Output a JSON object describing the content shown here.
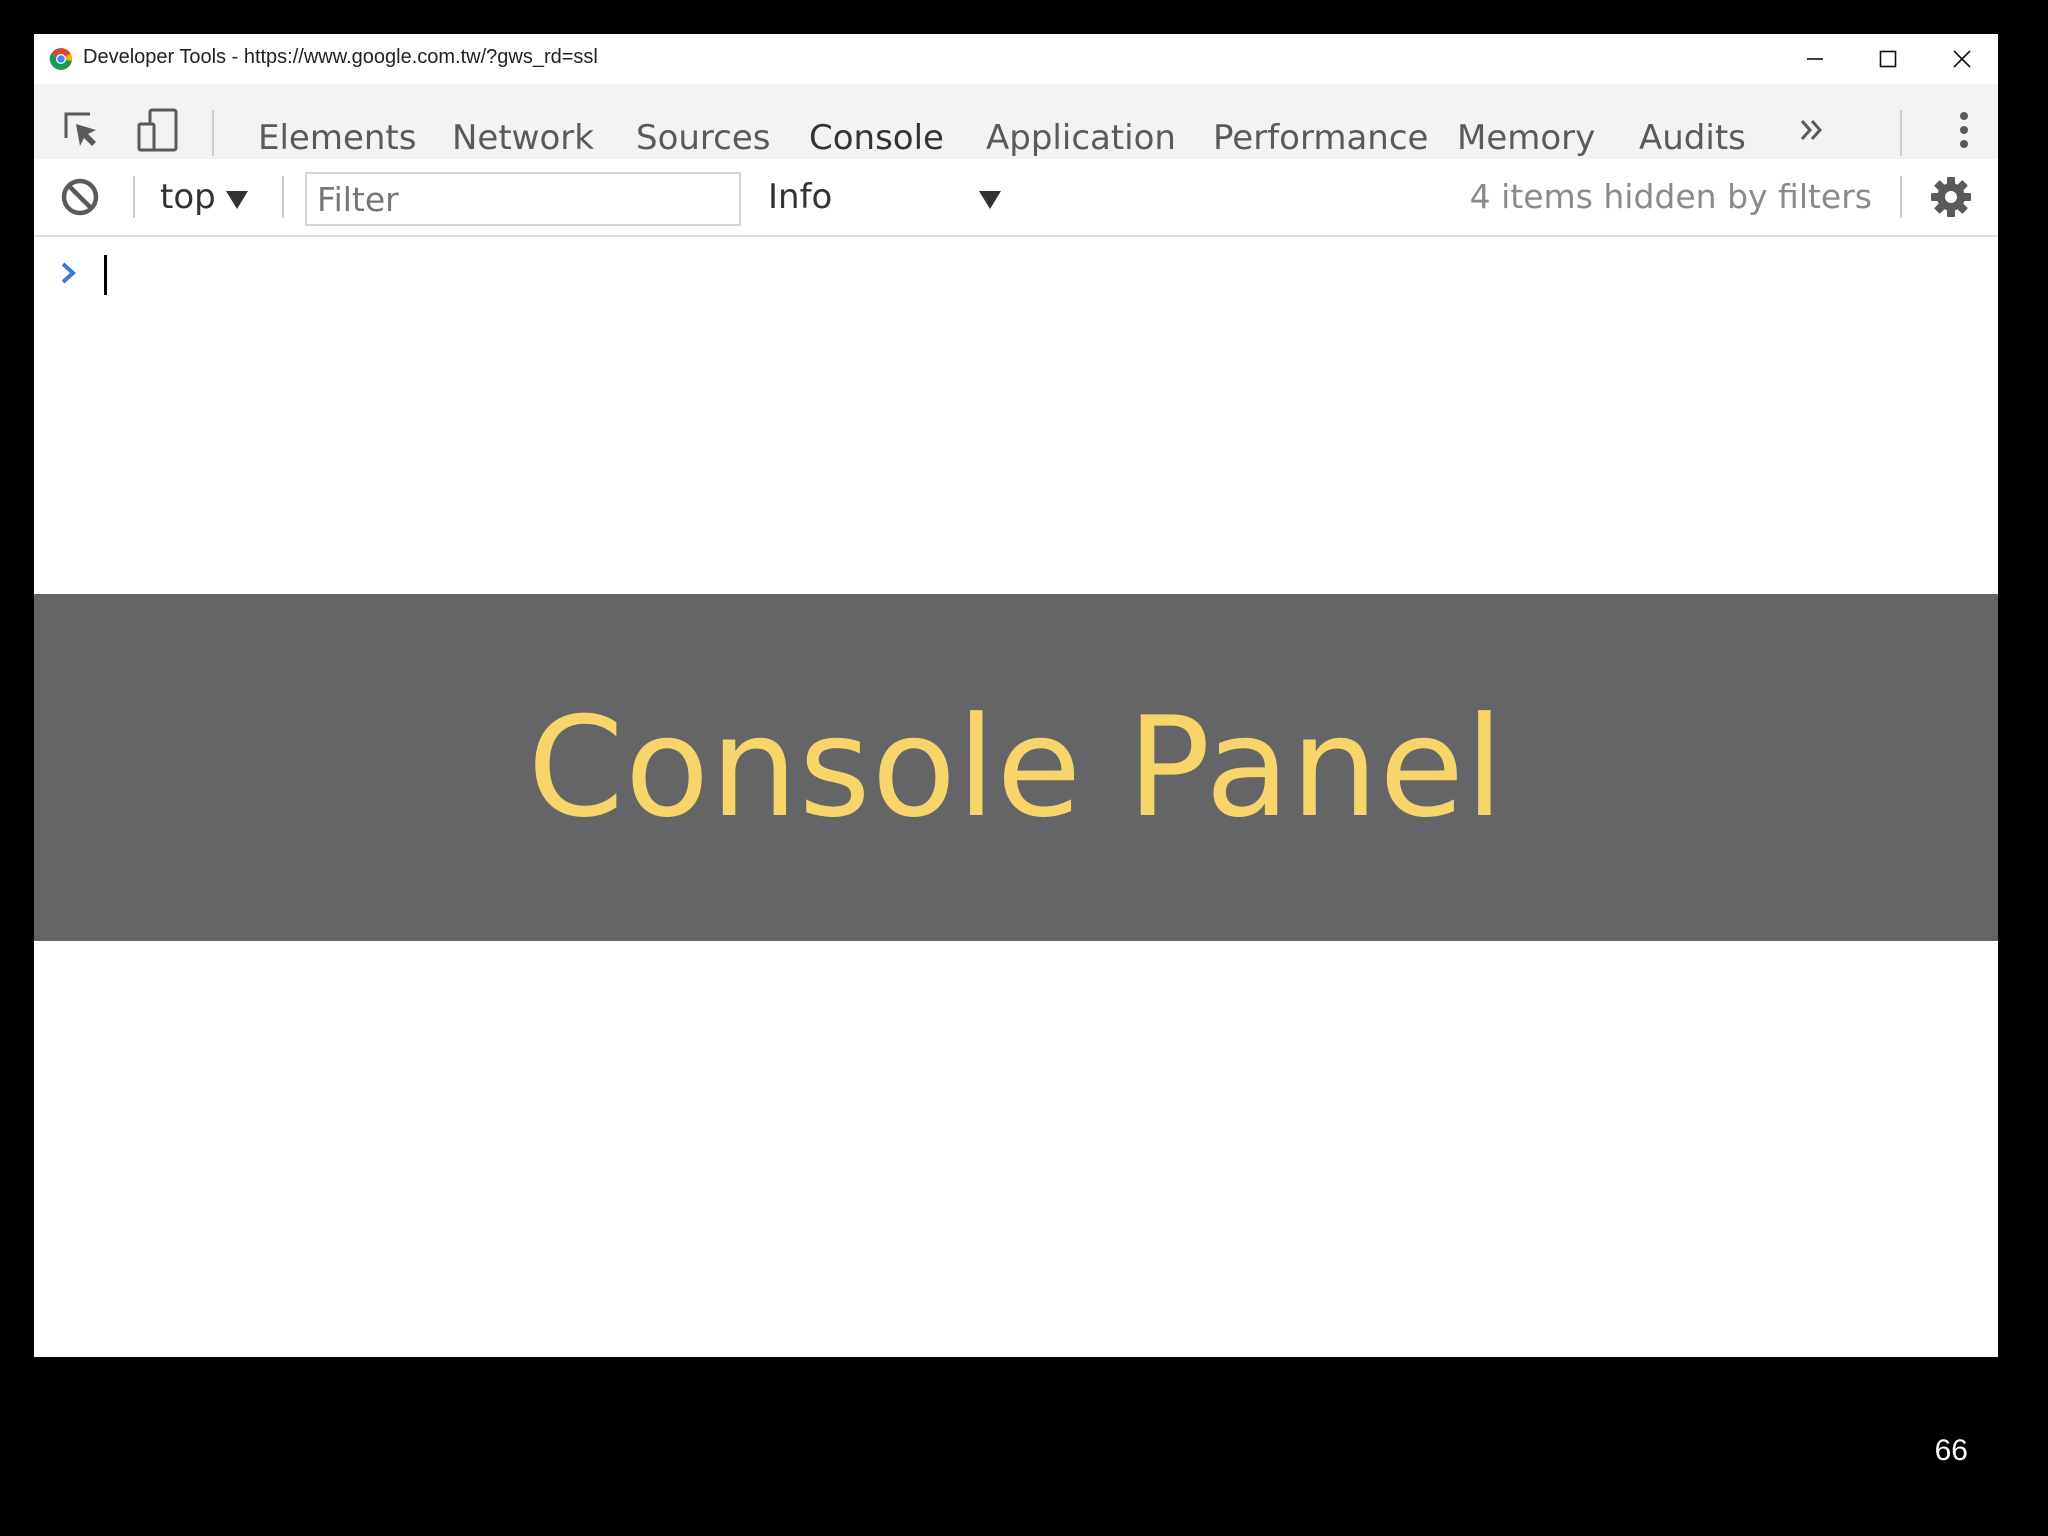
{
  "window": {
    "title": "Developer Tools - https://www.google.com.tw/?gws_rd=ssl"
  },
  "tabs": [
    {
      "label": "Elements",
      "active": false
    },
    {
      "label": "Network",
      "active": false
    },
    {
      "label": "Sources",
      "active": false
    },
    {
      "label": "Console",
      "active": true
    },
    {
      "label": "Application",
      "active": false
    },
    {
      "label": "Performance",
      "active": false
    },
    {
      "label": "Memory",
      "active": false
    },
    {
      "label": "Audits",
      "active": false
    }
  ],
  "console_toolbar": {
    "context": "top",
    "filter_placeholder": "Filter",
    "filter_value": "",
    "level": "Info",
    "hidden_count": "4 items hidden by filters"
  },
  "banner": {
    "title": "Console Panel"
  },
  "page_number": "66",
  "colors": {
    "accent": "#3879d9",
    "banner_bg": "#656567",
    "banner_text": "#f8d56b"
  }
}
